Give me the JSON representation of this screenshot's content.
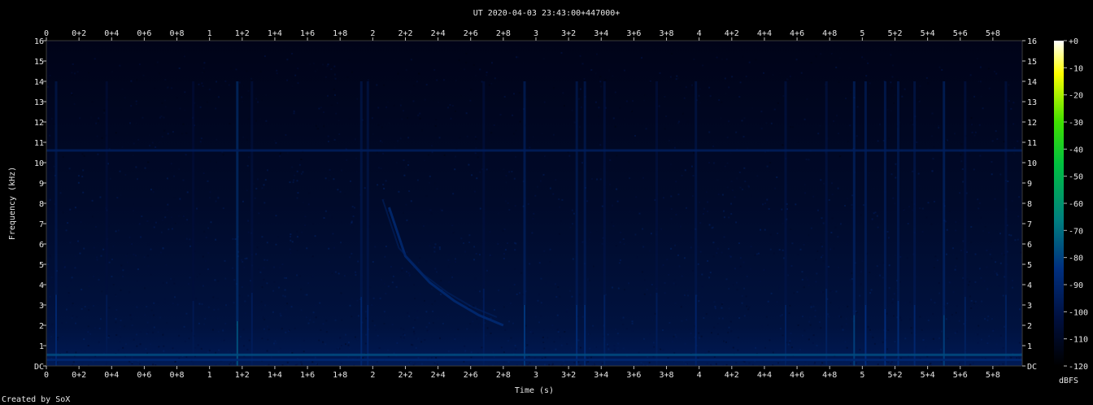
{
  "chart_data": {
    "type": "heatmap",
    "title": "UT 2020-04-03 23:43:00+447000+",
    "xlabel": "Time (s)",
    "ylabel": "Frequency (kHz)",
    "x_ticks": [
      "0",
      "0+2",
      "0+4",
      "0+6",
      "0+8",
      "1",
      "1+2",
      "1+4",
      "1+6",
      "1+8",
      "2",
      "2+2",
      "2+4",
      "2+6",
      "2+8",
      "3",
      "3+2",
      "3+4",
      "3+6",
      "3+8",
      "4",
      "4+2",
      "4+4",
      "4+6",
      "4+8",
      "5",
      "5+2",
      "5+4",
      "5+6",
      "5+8"
    ],
    "x_tick_values": [
      0,
      0.2,
      0.4,
      0.6,
      0.8,
      1.0,
      1.2,
      1.4,
      1.6,
      1.8,
      2.0,
      2.2,
      2.4,
      2.6,
      2.8,
      3.0,
      3.2,
      3.4,
      3.6,
      3.8,
      4.0,
      4.2,
      4.4,
      4.6,
      4.8,
      5.0,
      5.2,
      5.4,
      5.6,
      5.8
    ],
    "y_ticks": [
      "DC",
      "1",
      "2",
      "3",
      "4",
      "5",
      "6",
      "7",
      "8",
      "9",
      "10",
      "11",
      "12",
      "13",
      "14",
      "15",
      "16"
    ],
    "y_tick_values": [
      0,
      1,
      2,
      3,
      4,
      5,
      6,
      7,
      8,
      9,
      10,
      11,
      12,
      13,
      14,
      15,
      16
    ],
    "xlim": [
      0,
      5.98
    ],
    "ylim": [
      0,
      16
    ],
    "colorbar": {
      "label": "dBFS",
      "ticks": [
        "+0",
        "-10",
        "-20",
        "-30",
        "-40",
        "-50",
        "-60",
        "-70",
        "-80",
        "-90",
        "-100",
        "-110",
        "-120"
      ],
      "tick_values": [
        0,
        -10,
        -20,
        -30,
        -40,
        -50,
        -60,
        -70,
        -80,
        -90,
        -100,
        -110,
        -120
      ],
      "range": [
        -120,
        0
      ]
    },
    "background_level_dbfs": -110,
    "features": {
      "tone_lines": [
        {
          "freq_khz": 10.6,
          "level_dbfs": -95
        },
        {
          "freq_khz": 0.55,
          "level_dbfs": -80
        },
        {
          "freq_khz": 0.3,
          "level_dbfs": -90
        }
      ],
      "sferics": [
        {
          "t": 0.06,
          "f_low": 3.5,
          "level_dbfs": -90
        },
        {
          "t": 0.37,
          "f_low": 3.5,
          "level_dbfs": -98
        },
        {
          "t": 0.9,
          "f_low": 3.2,
          "level_dbfs": -98
        },
        {
          "t": 1.17,
          "f_low": 2.2,
          "level_dbfs": -78
        },
        {
          "t": 1.26,
          "f_low": 3.6,
          "level_dbfs": -96
        },
        {
          "t": 1.93,
          "f_low": 3.4,
          "level_dbfs": -90
        },
        {
          "t": 1.97,
          "f_low": 3.0,
          "level_dbfs": -92
        },
        {
          "t": 2.68,
          "f_low": 3.8,
          "level_dbfs": -96
        },
        {
          "t": 2.93,
          "f_low": 3.0,
          "level_dbfs": -84
        },
        {
          "t": 3.25,
          "f_low": 3.0,
          "level_dbfs": -88
        },
        {
          "t": 3.3,
          "f_low": 3.0,
          "level_dbfs": -88
        },
        {
          "t": 3.42,
          "f_low": 3.5,
          "level_dbfs": -94
        },
        {
          "t": 3.74,
          "f_low": 3.6,
          "level_dbfs": -96
        },
        {
          "t": 3.98,
          "f_low": 3.5,
          "level_dbfs": -92
        },
        {
          "t": 4.53,
          "f_low": 3.0,
          "level_dbfs": -94
        },
        {
          "t": 4.78,
          "f_low": 3.8,
          "level_dbfs": -94
        },
        {
          "t": 4.95,
          "f_low": 2.5,
          "level_dbfs": -82
        },
        {
          "t": 5.02,
          "f_low": 3.0,
          "level_dbfs": -86
        },
        {
          "t": 5.14,
          "f_low": 2.8,
          "level_dbfs": -86
        },
        {
          "t": 5.22,
          "f_low": 3.2,
          "level_dbfs": -88
        },
        {
          "t": 5.32,
          "f_low": 3.0,
          "level_dbfs": -90
        },
        {
          "t": 5.5,
          "f_low": 2.5,
          "level_dbfs": -82
        },
        {
          "t": 5.63,
          "f_low": 3.4,
          "level_dbfs": -94
        },
        {
          "t": 5.88,
          "f_low": 3.5,
          "level_dbfs": -94
        }
      ],
      "whistler": [
        {
          "t": 2.1,
          "f": 7.8
        },
        {
          "t": 2.2,
          "f": 5.4
        },
        {
          "t": 2.35,
          "f": 4.1
        },
        {
          "t": 2.5,
          "f": 3.2
        },
        {
          "t": 2.65,
          "f": 2.5
        },
        {
          "t": 2.8,
          "f": 2.0
        }
      ]
    }
  },
  "footer": {
    "credit": "Created by SoX"
  },
  "colors": {
    "background": "#000000",
    "text": "#e8e8e8",
    "colormap": [
      "#000000",
      "#001040",
      "#003080",
      "#008080",
      "#00c040",
      "#40e000",
      "#ffff00",
      "#ffffff"
    ]
  }
}
